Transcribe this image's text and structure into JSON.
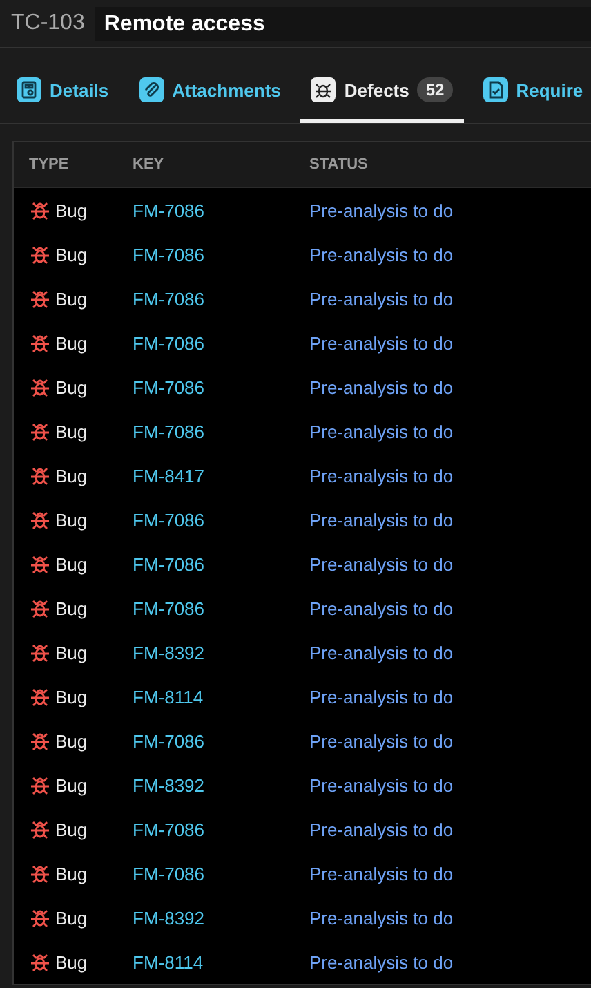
{
  "header": {
    "id": "TC-103",
    "title": "Remote access"
  },
  "tabs": [
    {
      "kind": "details",
      "label": "Details",
      "selected": false
    },
    {
      "kind": "attachments",
      "label": "Attachments",
      "selected": false
    },
    {
      "kind": "defects",
      "label": "Defects",
      "count": "52",
      "selected": true
    },
    {
      "kind": "requirements",
      "label": "Require",
      "selected": false
    }
  ],
  "table": {
    "columns": [
      "TYPE",
      "KEY",
      "STATUS"
    ],
    "rows": [
      {
        "type": "Bug",
        "key": "FM-7086",
        "status": "Pre-analysis to do"
      },
      {
        "type": "Bug",
        "key": "FM-7086",
        "status": "Pre-analysis to do"
      },
      {
        "type": "Bug",
        "key": "FM-7086",
        "status": "Pre-analysis to do"
      },
      {
        "type": "Bug",
        "key": "FM-7086",
        "status": "Pre-analysis to do"
      },
      {
        "type": "Bug",
        "key": "FM-7086",
        "status": "Pre-analysis to do"
      },
      {
        "type": "Bug",
        "key": "FM-7086",
        "status": "Pre-analysis to do"
      },
      {
        "type": "Bug",
        "key": "FM-8417",
        "status": "Pre-analysis to do"
      },
      {
        "type": "Bug",
        "key": "FM-7086",
        "status": "Pre-analysis to do"
      },
      {
        "type": "Bug",
        "key": "FM-7086",
        "status": "Pre-analysis to do"
      },
      {
        "type": "Bug",
        "key": "FM-7086",
        "status": "Pre-analysis to do"
      },
      {
        "type": "Bug",
        "key": "FM-8392",
        "status": "Pre-analysis to do"
      },
      {
        "type": "Bug",
        "key": "FM-8114",
        "status": "Pre-analysis to do"
      },
      {
        "type": "Bug",
        "key": "FM-7086",
        "status": "Pre-analysis to do"
      },
      {
        "type": "Bug",
        "key": "FM-8392",
        "status": "Pre-analysis to do"
      },
      {
        "type": "Bug",
        "key": "FM-7086",
        "status": "Pre-analysis to do"
      },
      {
        "type": "Bug",
        "key": "FM-7086",
        "status": "Pre-analysis to do"
      },
      {
        "type": "Bug",
        "key": "FM-8392",
        "status": "Pre-analysis to do"
      },
      {
        "type": "Bug",
        "key": "FM-8114",
        "status": "Pre-analysis to do"
      }
    ]
  }
}
